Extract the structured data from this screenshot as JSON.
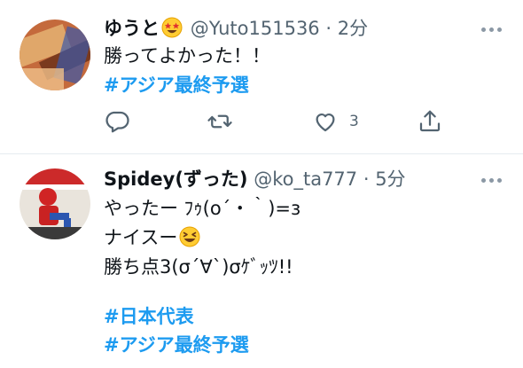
{
  "tweets": [
    {
      "display_name": "ゆうと",
      "handle": "@Yuto151536",
      "time": "2分",
      "lines": [
        "勝ってよかった！！"
      ],
      "hashtags": [
        "#アジア最終予選"
      ],
      "actions": {
        "like_count": "3"
      }
    },
    {
      "display_name": "Spidey(ずった)",
      "handle": "@ko_ta777",
      "time": "5分",
      "lines": [
        "やったー ﾌｩ(o´・｀)=з",
        "ナイスー",
        "勝ち点3(σ´∀`)σｹﾞｯﾂ!!"
      ],
      "hashtags": [
        "#日本代表",
        "#アジア最終予選"
      ]
    }
  ],
  "colors": {
    "link": "#1d9bf0",
    "meta": "#536471",
    "icon": "#536471",
    "divider": "#e6ecf0"
  },
  "icons": [
    "star-struck-emoji",
    "reply-icon",
    "retweet-icon",
    "like-icon",
    "share-icon",
    "more-icon",
    "grinning-squinting-emoji"
  ]
}
